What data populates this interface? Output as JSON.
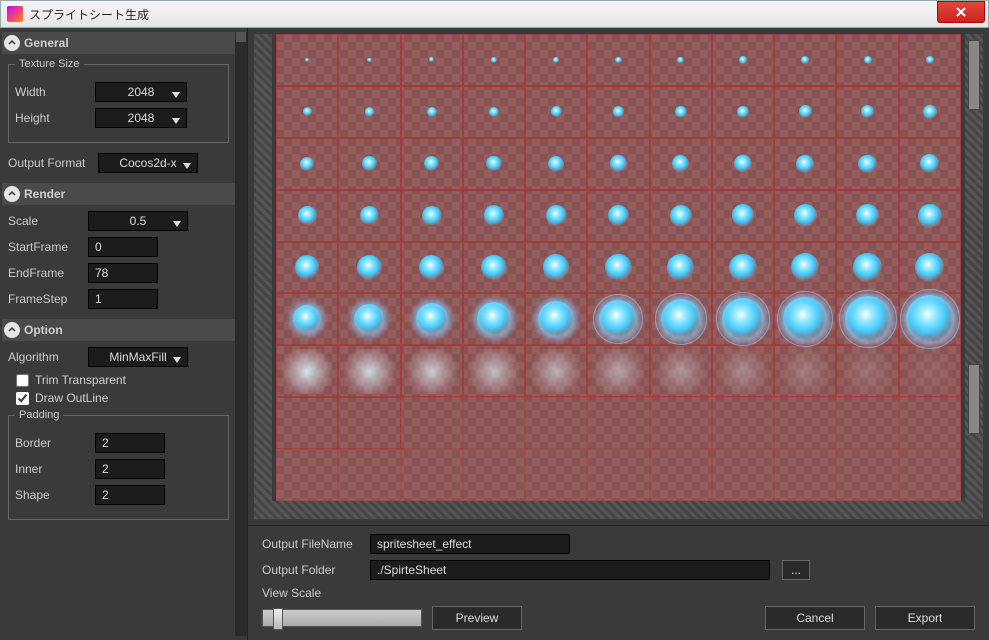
{
  "window": {
    "title": "スプライトシート生成"
  },
  "sidebar": {
    "general": {
      "header": "General",
      "textureSizeLegend": "Texture Size",
      "widthLabel": "Width",
      "widthValue": "2048",
      "heightLabel": "Height",
      "heightValue": "2048",
      "outputFormatLabel": "Output Format",
      "outputFormatValue": "Cocos2d-x"
    },
    "render": {
      "header": "Render",
      "scaleLabel": "Scale",
      "scaleValue": "0.5",
      "startFrameLabel": "StartFrame",
      "startFrameValue": "0",
      "endFrameLabel": "EndFrame",
      "endFrameValue": "78",
      "frameStepLabel": "FrameStep",
      "frameStepValue": "1"
    },
    "option": {
      "header": "Option",
      "algorithmLabel": "Algorithm",
      "algorithmValue": "MinMaxFill",
      "trimLabel": "Trim Transparent",
      "trimChecked": false,
      "outlineLabel": "Draw OutLine",
      "outlineChecked": true,
      "paddingLegend": "Padding",
      "borderLabel": "Border",
      "borderValue": "2",
      "innerLabel": "Inner",
      "innerValue": "2",
      "shapeLabel": "Shape",
      "shapeValue": "2"
    }
  },
  "bottom": {
    "outputFileNameLabel": "Output FileName",
    "outputFileNameValue": "spritesheet_effect",
    "outputFolderLabel": "Output Folder",
    "outputFolderValue": "./SpirteSheet",
    "browseLabel": "...",
    "viewScaleLabel": "View Scale",
    "previewLabel": "Preview",
    "cancelLabel": "Cancel",
    "exportLabel": "Export"
  }
}
